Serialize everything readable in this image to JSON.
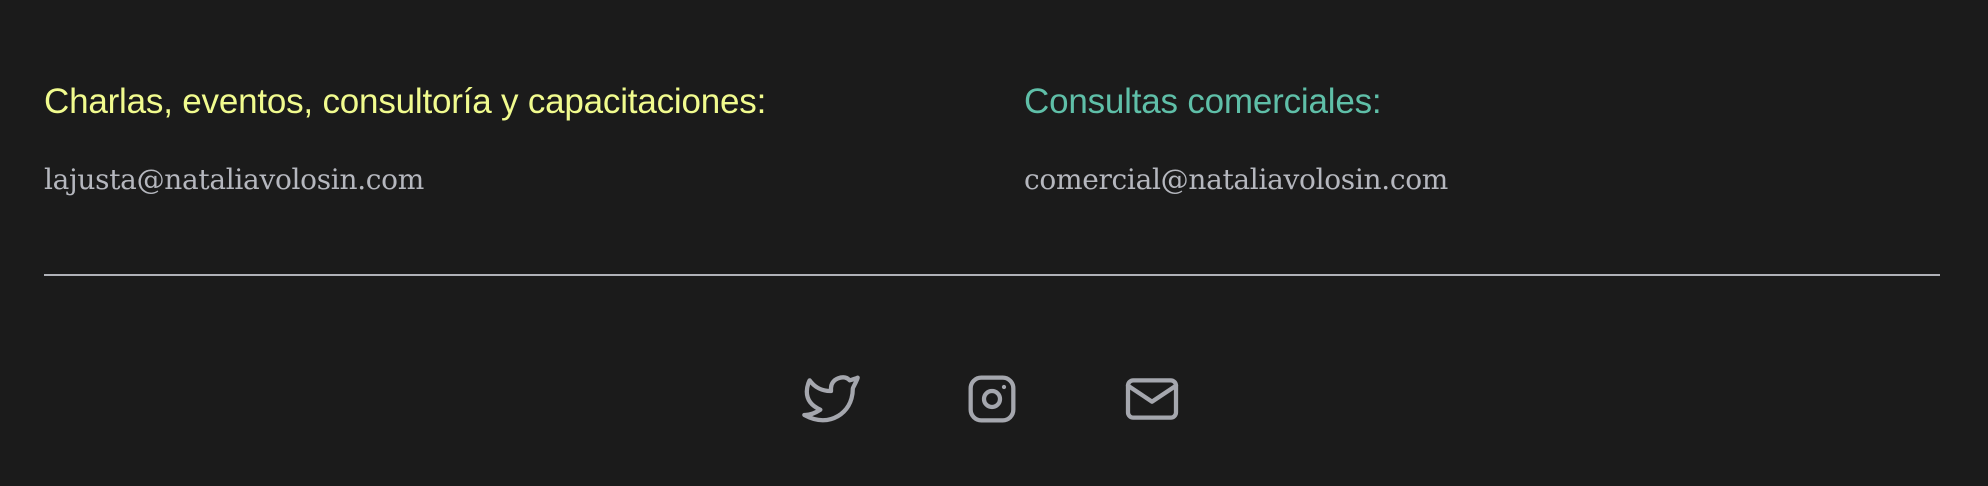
{
  "contacts": [
    {
      "heading": "Charlas, eventos, consultoría y capacitaciones:",
      "email": "lajusta@nataliavolosin.com",
      "heading_color": "#f1fb8e"
    },
    {
      "heading": "Consultas comerciales:",
      "email": "comercial@nataliavolosin.com",
      "heading_color": "#5fbfa8"
    }
  ],
  "colors": {
    "background": "#1b1b1b",
    "email_text": "#b5b7be",
    "divider": "#b0b2b8",
    "icon": "#a5a7ae"
  },
  "social": [
    {
      "icon": "twitter-icon"
    },
    {
      "icon": "instagram-icon"
    },
    {
      "icon": "mail-icon"
    }
  ]
}
